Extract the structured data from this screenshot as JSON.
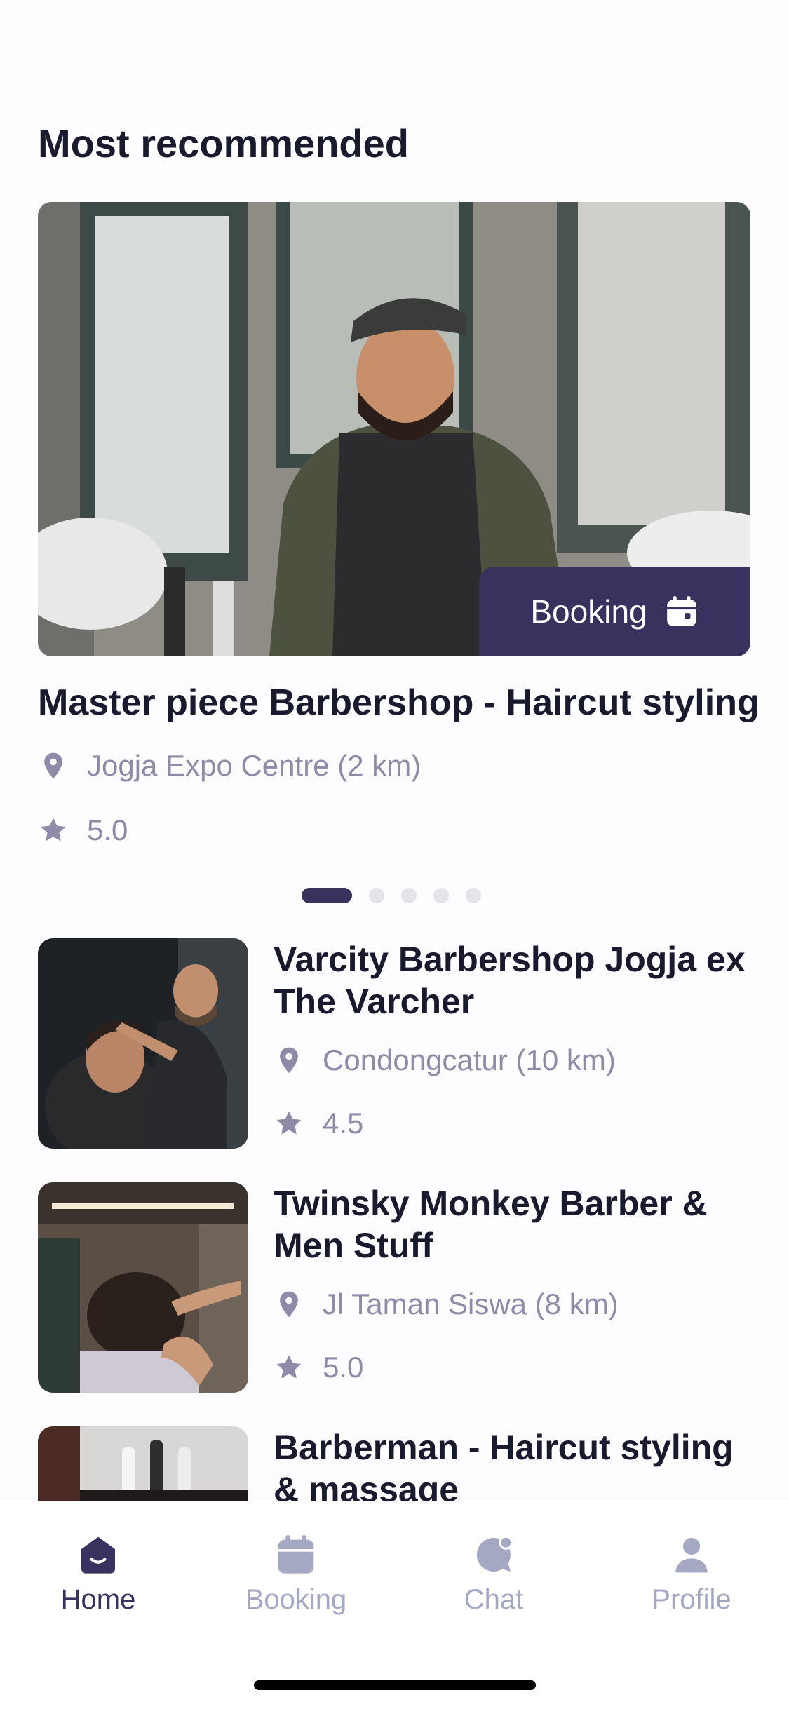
{
  "section": {
    "title": "Most recommended"
  },
  "hero": {
    "name": "Master piece Barbershop - Haircut styling",
    "location": "Jogja Expo Centre (2 km)",
    "rating": "5.0",
    "booking_label": "Booking"
  },
  "carousel": {
    "count": 5,
    "active_index": 0
  },
  "list": [
    {
      "name": "Varcity Barbershop Jogja ex The Varcher",
      "location": "Condongcatur (10 km)",
      "rating": "4.5"
    },
    {
      "name": "Twinsky Monkey Barber & Men Stuff",
      "location": "Jl Taman Siswa (8 km)",
      "rating": "5.0"
    },
    {
      "name": "Barberman - Haircut styling & massage",
      "location": "",
      "rating": ""
    }
  ],
  "tabs": [
    {
      "label": "Home",
      "icon": "home-icon",
      "active": true
    },
    {
      "label": "Booking",
      "icon": "calendar-icon",
      "active": false
    },
    {
      "label": "Chat",
      "icon": "chat-icon",
      "active": false
    },
    {
      "label": "Profile",
      "icon": "profile-icon",
      "active": false
    }
  ],
  "colors": {
    "primary": "#39325F",
    "muted": "#8E8AA8",
    "inactive_tab": "#A4A8C2",
    "text": "#1A1A2E"
  }
}
